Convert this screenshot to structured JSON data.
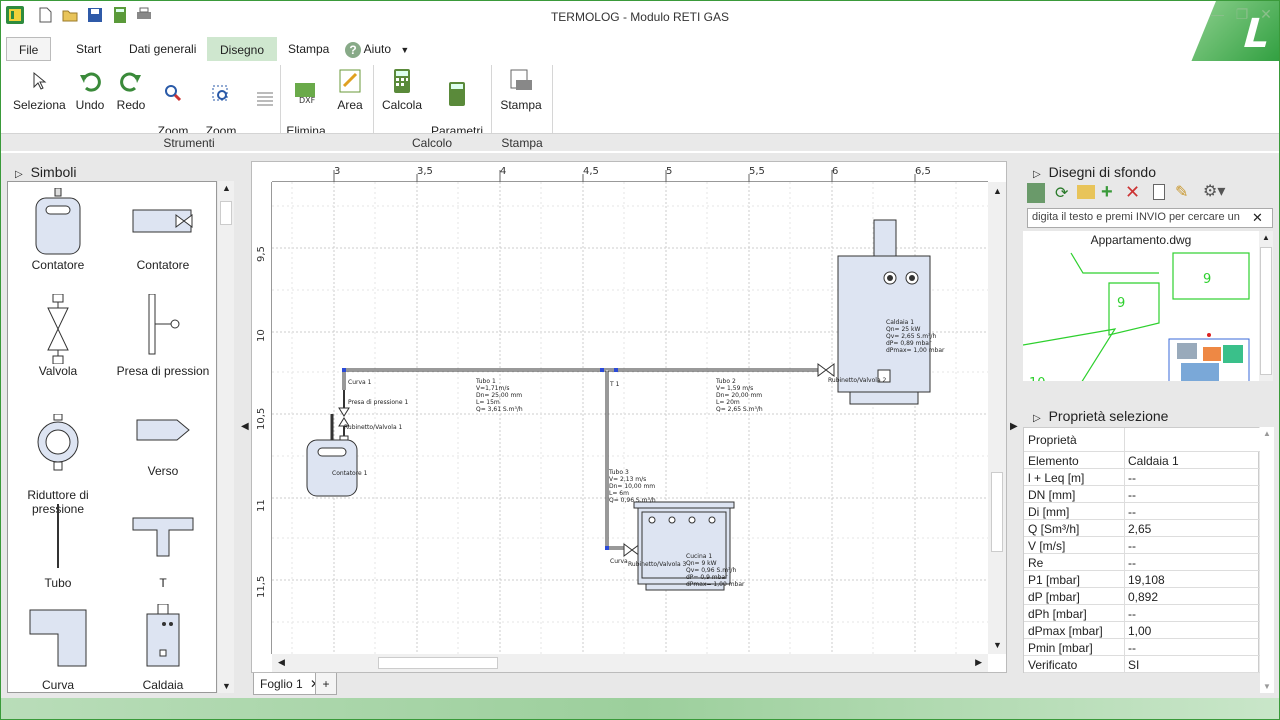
{
  "app": {
    "title": "TERMOLOG - Modulo RETI GAS"
  },
  "menu": {
    "file": "File",
    "tabs": [
      "Start",
      "Dati generali",
      "Disegno",
      "Stampa",
      "Aiuto"
    ]
  },
  "ribbon": {
    "buttons": {
      "seleziona": "Seleziona",
      "undo": "Undo",
      "redo": "Redo",
      "zoom_tutto": "Zoom\nTutto",
      "zoom_finestra": "Zoom\nFinestra",
      "elimina_sfondo": "Elimina\nsfondo",
      "area": "Area",
      "calcola": "Calcola",
      "parametri": "Parametri\ndi calcolo",
      "stampa": "Stampa"
    },
    "groups": {
      "strumenti": "Strumenti",
      "calcolo": "Calcolo",
      "stampa": "Stampa"
    }
  },
  "symbols": {
    "title": "Simboli",
    "items": [
      "Contatore",
      "Contatore",
      "Valvola",
      "Presa di pression",
      "Riduttore di\npressione",
      "Verso",
      "Tubo",
      "T",
      "Curva",
      "Caldaia"
    ]
  },
  "canvas": {
    "ruler_top": [
      "3",
      "3,5",
      "4",
      "4,5",
      "5",
      "5,5",
      "6",
      "6,5"
    ],
    "ruler_left": [
      "9,5",
      "10",
      "10,5",
      "11",
      "11,5"
    ],
    "sheet_tab": "Foglio 1",
    "labels": {
      "curva1": "Curva 1",
      "presa1": "Presa di pressione 1",
      "rubinetto1": "Rubinetto/Valvola 1",
      "contatore1": "Contatore 1",
      "tubo1": [
        "Tubo 1",
        "V=1,71m/s",
        "Dn= 25,00 mm",
        "L= 15m",
        "Q= 3,61 S.m³/h"
      ],
      "tubo2": [
        "Tubo 2",
        "V= 1,59 m/s",
        "Dn= 20,00 mm",
        "L= 20m",
        "Q= 2,65 S.m³/h"
      ],
      "tubo3": [
        "Tubo 3",
        "V= 2,13 m/s",
        "Dn= 10,00 mm",
        "L= 6m",
        "Q= 0,96 S.m³/h"
      ],
      "rubinetto2": "Rubinetto/Valvola 2",
      "rubinetto3": "Rubinetto/Valvola 3",
      "curva2": "Curva",
      "caldaia1": [
        "Caldaia 1",
        "Qn= 25 kW",
        "Qv= 2,65 S.m³/h",
        "dP= 0,89 mbar",
        "dPmax= 1,00 mbar"
      ],
      "cucina1": [
        "Cucina 1",
        "Qn= 9 kW",
        "Qv= 0,96 S.m³/h",
        "dP= 0,9 mbar",
        "dPmax= 1,00 mbar"
      ],
      "t1": "T 1"
    }
  },
  "background_panel": {
    "title": "Disegni di sfondo",
    "search_placeholder": "digita il testo e premi INVIO per cercare un",
    "file": "Appartamento.dwg",
    "numbers": [
      "9",
      "9",
      "10"
    ]
  },
  "properties": {
    "title": "Proprietà selezione",
    "header": "Proprietà",
    "rows": [
      [
        "Elemento",
        "Caldaia 1"
      ],
      [
        "l + Leq [m]",
        "--"
      ],
      [
        "DN [mm]",
        "--"
      ],
      [
        "Di [mm]",
        "--"
      ],
      [
        "Q [Sm³/h]",
        "2,65"
      ],
      [
        "V [m/s]",
        "--"
      ],
      [
        "Re",
        "--"
      ],
      [
        "P1 [mbar]",
        "19,108"
      ],
      [
        "dP [mbar]",
        "0,892"
      ],
      [
        "dPh [mbar]",
        "--"
      ],
      [
        "dPmax [mbar]",
        "1,00"
      ],
      [
        "Pmin [mbar]",
        "--"
      ],
      [
        "Verificato",
        "SI"
      ]
    ]
  }
}
